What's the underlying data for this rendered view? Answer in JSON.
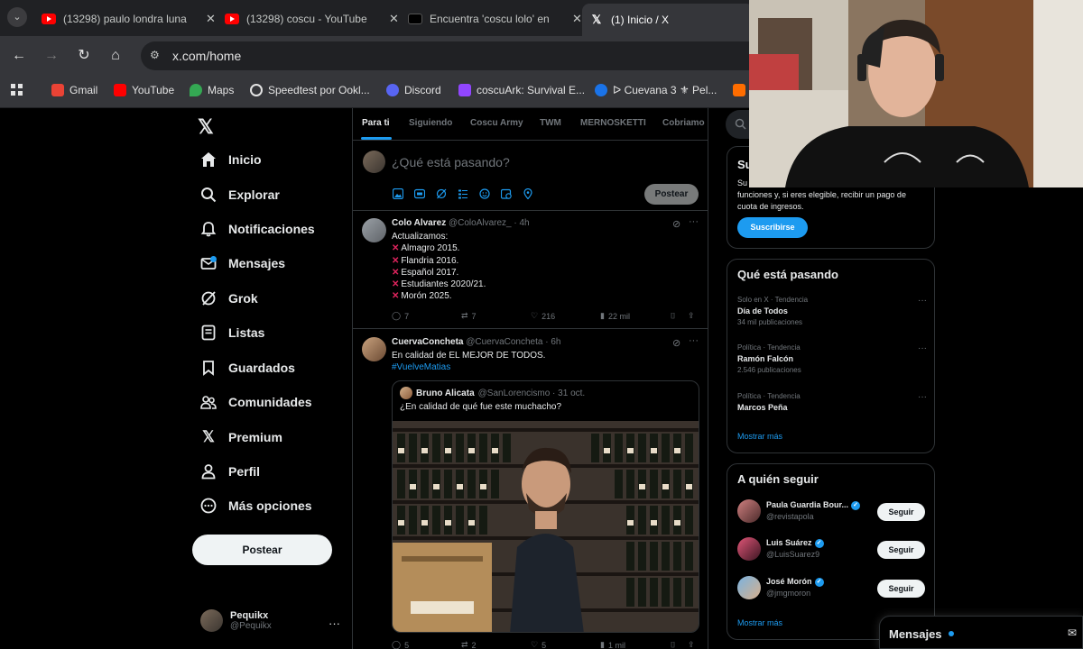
{
  "browser": {
    "tabs": [
      {
        "title": "(13298) paulo londra luna",
        "favicon": "youtube-icon"
      },
      {
        "title": "(13298) coscu - YouTube",
        "favicon": "youtube-icon"
      },
      {
        "title": "Encuentra 'coscu lolo' en",
        "favicon": "tiktok-icon"
      },
      {
        "title": "(1) Inicio / X",
        "favicon": "x-icon"
      }
    ],
    "url": "x.com/home",
    "bookmarks": [
      {
        "label": "Gmail",
        "color": "#ea4335"
      },
      {
        "label": "YouTube",
        "color": "#ff0000"
      },
      {
        "label": "Maps",
        "color": "#34a853"
      },
      {
        "label": "Speedtest por Ookl...",
        "color": "#9aa0a6"
      },
      {
        "label": "Discord",
        "color": "#5865f2"
      },
      {
        "label": "coscuArk: Survival E...",
        "color": "#9146ff"
      },
      {
        "label": "ᐅ Cuevana 3 ⚜ Pel...",
        "color": "#1a73e8"
      }
    ]
  },
  "sidebar": {
    "items": [
      {
        "label": "Inicio",
        "icon": "home-icon"
      },
      {
        "label": "Explorar",
        "icon": "search-icon"
      },
      {
        "label": "Notificaciones",
        "icon": "bell-icon"
      },
      {
        "label": "Mensajes",
        "icon": "mail-icon"
      },
      {
        "label": "Grok",
        "icon": "grok-icon"
      },
      {
        "label": "Listas",
        "icon": "list-icon"
      },
      {
        "label": "Guardados",
        "icon": "bookmark-icon"
      },
      {
        "label": "Comunidades",
        "icon": "communities-icon"
      },
      {
        "label": "Premium",
        "icon": "x-premium-icon"
      },
      {
        "label": "Perfil",
        "icon": "person-icon"
      },
      {
        "label": "Más opciones",
        "icon": "more-circle-icon"
      }
    ],
    "post_button": "Postear",
    "account": {
      "name": "Pequikx",
      "handle": "@Pequikx"
    }
  },
  "feed": {
    "tabs": [
      "Para ti",
      "Siguiendo",
      "Coscu Army",
      "TWM",
      "MERNOSKETTI",
      "Cobriamo"
    ],
    "composer": {
      "placeholder": "¿Qué está pasando?",
      "post_label": "Postear"
    },
    "tweets": [
      {
        "name": "Colo Alvarez",
        "meta": "@ColoAlvarez_ · 4h",
        "intro": "Actualizamos:",
        "lines": [
          "Almagro 2015.",
          "Flandria 2016.",
          "Español 2017.",
          "Estudiantes 2020/21.",
          "Morón 2025."
        ],
        "replies": "7",
        "retweets": "7",
        "likes": "216",
        "views": "22 mil"
      },
      {
        "name": "CuervaConcheta",
        "meta": "@CuervaConcheta · 6h",
        "text": "En calidad de EL MEJOR DE TODOS.",
        "hashtag": "#VuelveMatias",
        "quote": {
          "name": "Bruno Alicata",
          "meta": "@SanLorencismo · 31 oct.",
          "text": "¿En calidad de qué fue este muchacho?"
        },
        "replies": "5",
        "retweets": "2",
        "likes": "5",
        "views": "1 mil"
      }
    ]
  },
  "right": {
    "premium": {
      "title_partial": "Su",
      "text_lead": "Su",
      "text": "funciones y, si eres elegible, recibir un pago de cuota de ingresos.",
      "button": "Suscribirse"
    },
    "trends": {
      "title": "Qué está pasando",
      "items": [
        {
          "context": "Solo en X · Tendencia",
          "name": "Día de Todos",
          "posts": "34 mil publicaciones"
        },
        {
          "context": "Política · Tendencia",
          "name": "Ramón Falcón",
          "posts": "2.546 publicaciones"
        },
        {
          "context": "Política · Tendencia",
          "name": "Marcos Peña",
          "posts": ""
        }
      ],
      "show_more": "Mostrar más"
    },
    "who_to_follow": {
      "title": "A quién seguir",
      "items": [
        {
          "name": "Paula Guardia Bour...",
          "handle": "@revistapola",
          "button": "Seguir"
        },
        {
          "name": "Luis Suárez",
          "handle": "@LuisSuarez9",
          "button": "Seguir"
        },
        {
          "name": "José Morón",
          "handle": "@jmgmoron",
          "button": "Seguir"
        }
      ],
      "show_more": "Mostrar más"
    },
    "messages": {
      "label": "Mensajes"
    }
  },
  "colors": {
    "accent": "#1d9bf0",
    "background": "#000000",
    "border": "#2f3336",
    "muted": "#71767b"
  }
}
